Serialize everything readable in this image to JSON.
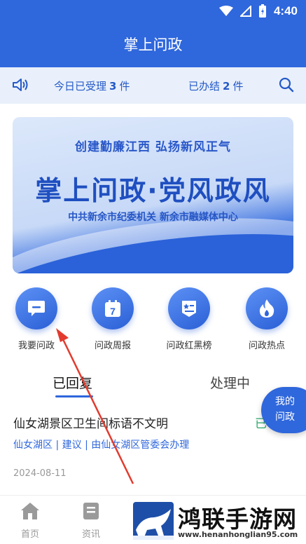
{
  "status_bar": {
    "time": "4:40"
  },
  "header": {
    "title": "掌上问政"
  },
  "info_bar": {
    "today_prefix": "今日已受理",
    "today_count": "3",
    "today_unit": "件",
    "done_prefix": "已办结",
    "done_count": "2",
    "done_unit": "件"
  },
  "banner": {
    "slogan": "创建勤廉江西    弘扬新风正气",
    "headline": "掌上问政·党风政风",
    "org": "中共新余市纪委机关 新余市融媒体中心"
  },
  "quick_actions": [
    {
      "label": "我要问政",
      "icon": "message-icon"
    },
    {
      "label": "问政周报",
      "icon": "calendar-icon"
    },
    {
      "label": "问政红黑榜",
      "icon": "badge-icon"
    },
    {
      "label": "问政热点",
      "icon": "flame-icon"
    }
  ],
  "tabs": {
    "replied": "已回复",
    "processing": "处理中"
  },
  "list": [
    {
      "title": "仙女湖景区卫生间标语不文明",
      "status": "已",
      "meta": "仙女湖区 | 建议 | 由仙女湖区管委会办理",
      "date": "2024-08-11"
    }
  ],
  "float_button": {
    "line1": "我的",
    "line2": "问政"
  },
  "bottom_nav": {
    "home": "首页",
    "news": "资讯"
  },
  "watermark": {
    "text": "鸿联手游网",
    "url": "www.henanhonglian95.com"
  },
  "colors": {
    "primary": "#2f67dc",
    "status_green": "#2aa86a",
    "infobar_bg": "#e9f0fb"
  }
}
